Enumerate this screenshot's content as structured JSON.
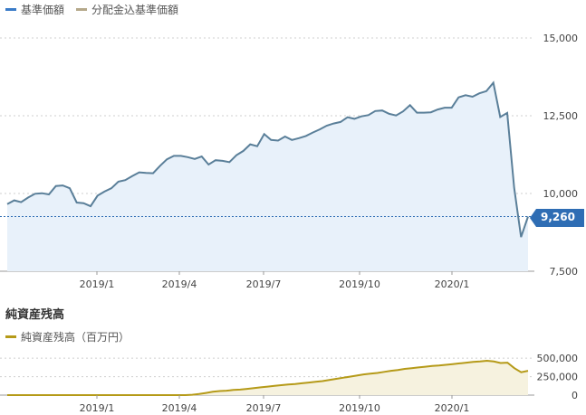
{
  "legend": {
    "series1": "基準価額",
    "series1_color": "#3A7BC8",
    "series2": "分配金込基準価額",
    "series2_color": "#B5A88A"
  },
  "net_assets": {
    "title": "純資産残高",
    "legend": "純資産残高（百万円）",
    "color": "#B59A18"
  },
  "current_badge": "9,260",
  "chart_data": [
    {
      "type": "area",
      "series": [
        {
          "name": "基準価額",
          "color": "#5A7F99",
          "values": [
            9660,
            9780,
            9720,
            9870,
            9990,
            10010,
            9970,
            10240,
            10260,
            10170,
            9710,
            9690,
            9590,
            9930,
            10060,
            10170,
            10380,
            10430,
            10560,
            10680,
            10660,
            10650,
            10890,
            11100,
            11210,
            11210,
            11170,
            11110,
            11190,
            10930,
            11070,
            11050,
            11010,
            11230,
            11370,
            11580,
            11520,
            11910,
            11720,
            11700,
            11830,
            11720,
            11780,
            11850,
            11960,
            12060,
            12180,
            12250,
            12300,
            12450,
            12400,
            12480,
            12520,
            12650,
            12670,
            12560,
            12510,
            12640,
            12840,
            12600,
            12600,
            12610,
            12700,
            12760,
            12760,
            13090,
            13160,
            13110,
            13220,
            13290,
            13560,
            12460,
            12590,
            10180,
            8600,
            9260
          ]
        }
      ],
      "ylim": [
        7500,
        15000
      ],
      "yticks": [
        "15,000",
        "12,500",
        "10,000",
        "7,500"
      ],
      "xticks": [
        "2019/1",
        "2019/4",
        "2019/7",
        "2019/10",
        "2020/1"
      ],
      "reference_line": 9260
    },
    {
      "type": "area",
      "series": [
        {
          "name": "純資産残高（百万円）",
          "color": "#B59A18",
          "values": [
            0,
            0,
            0,
            0,
            0,
            0,
            0,
            0,
            0,
            0,
            0,
            0,
            0,
            0,
            0,
            0,
            0,
            0,
            0,
            0,
            0,
            0,
            0,
            0,
            0,
            0,
            0,
            5000,
            15000,
            30000,
            45000,
            55000,
            60000,
            70000,
            75000,
            85000,
            95000,
            105000,
            115000,
            125000,
            135000,
            145000,
            150000,
            160000,
            170000,
            180000,
            190000,
            205000,
            220000,
            235000,
            250000,
            265000,
            280000,
            290000,
            300000,
            315000,
            330000,
            340000,
            355000,
            365000,
            375000,
            385000,
            395000,
            400000,
            410000,
            420000,
            430000,
            440000,
            450000,
            455000,
            465000,
            455000,
            435000,
            440000,
            365000,
            310000,
            330000
          ]
        }
      ],
      "ylim": [
        0,
        600000
      ],
      "yticks": [
        "500,000",
        "250,000",
        "0"
      ],
      "xticks": [
        "2019/1",
        "2019/4",
        "2019/7",
        "2019/10",
        "2020/1"
      ]
    }
  ]
}
